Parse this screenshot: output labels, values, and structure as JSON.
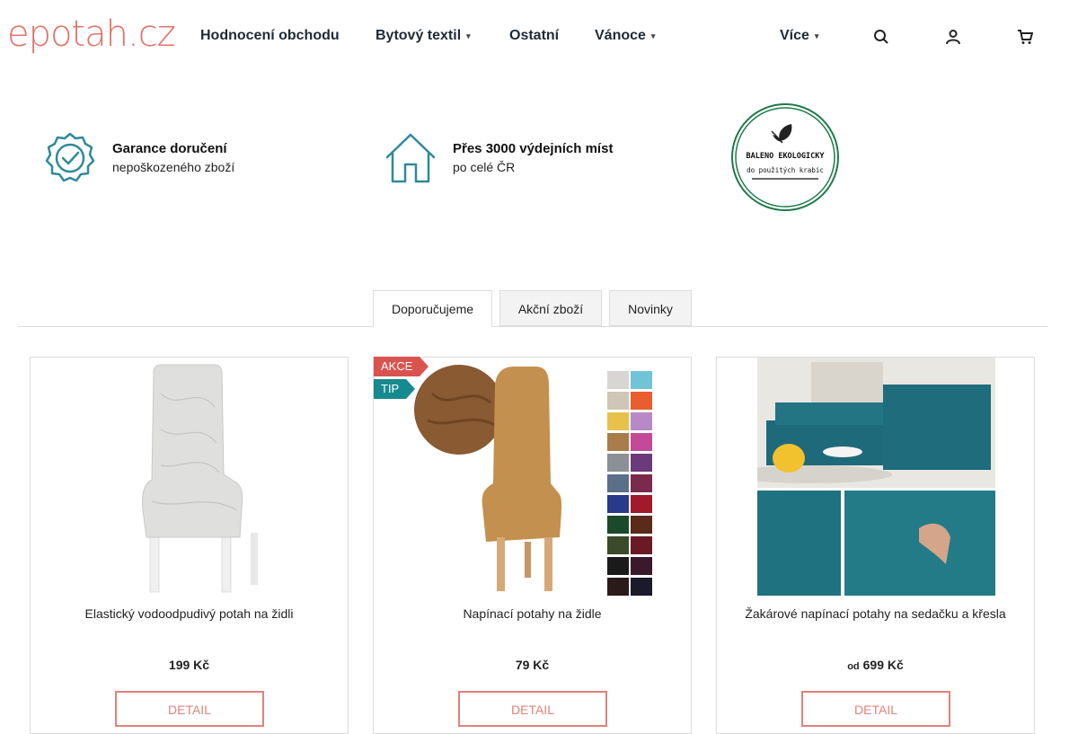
{
  "header": {
    "logo": "epotah.cz",
    "nav": [
      {
        "label": "Hodnocení obchodu",
        "has_dropdown": false
      },
      {
        "label": "Bytový textil",
        "has_dropdown": true
      },
      {
        "label": "Ostatní",
        "has_dropdown": false
      },
      {
        "label": "Vánoce",
        "has_dropdown": true
      },
      {
        "label": "Více",
        "has_dropdown": true
      }
    ],
    "icons": [
      "search-icon",
      "user-icon",
      "cart-icon"
    ]
  },
  "benefits": [
    {
      "title": "Garance doručení",
      "subtitle": "nepoškozeného zboží",
      "icon": "badge-check-icon"
    },
    {
      "title": "Přes 3000 výdejních míst",
      "subtitle": "po celé ČR",
      "icon": "house-icon"
    }
  ],
  "eco_badge": {
    "line1": "BALENO EKOLOGICKY",
    "line2": "do použitých krabic"
  },
  "tabs": [
    {
      "label": "Doporučujeme",
      "active": true
    },
    {
      "label": "Akční zboží",
      "active": false
    },
    {
      "label": "Novinky",
      "active": false
    }
  ],
  "products": [
    {
      "name": "Elastický vodoodpudivý potah na židli",
      "price": "199 Kč",
      "price_prefix": "",
      "button": "DETAIL",
      "flags": []
    },
    {
      "name": "Napínací potahy na židle",
      "price": "79 Kč",
      "price_prefix": "",
      "button": "DETAIL",
      "flags": [
        "AKCE",
        "TIP"
      ]
    },
    {
      "name": "Žakárové napínací potahy na sedačku a křesla",
      "price": "699 Kč",
      "price_prefix": "od",
      "button": "DETAIL",
      "flags": []
    }
  ],
  "colors": {
    "brand": "#e3726a",
    "teal": "#178a8f",
    "sale": "#d9534f"
  }
}
